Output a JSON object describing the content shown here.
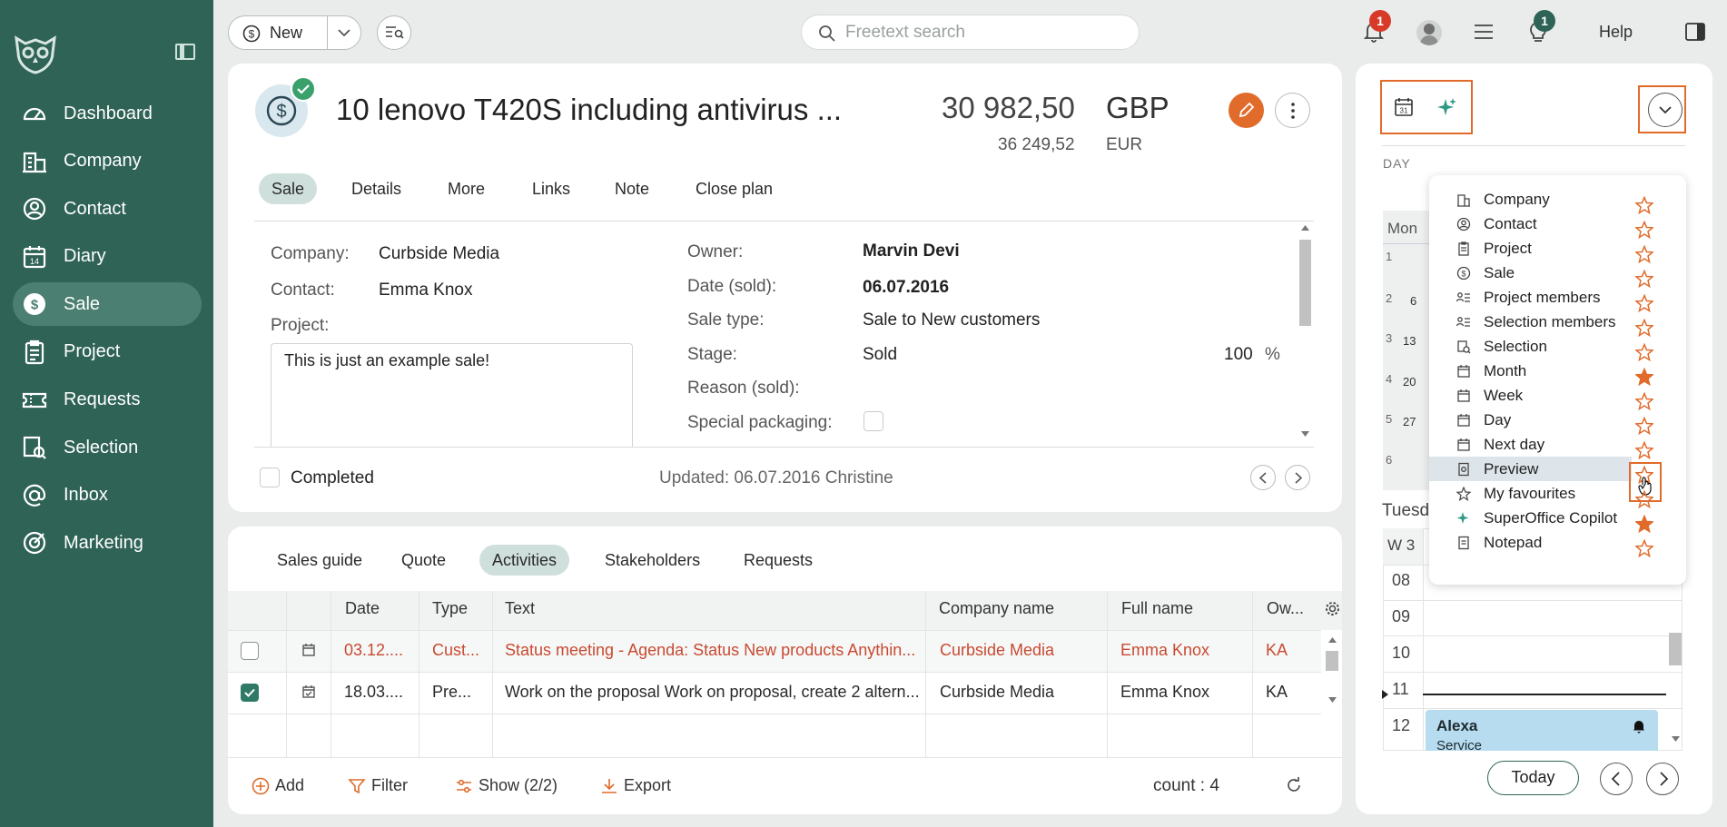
{
  "sidebar": {
    "items": [
      {
        "label": "Dashboard",
        "icon": "dashboard-icon"
      },
      {
        "label": "Company",
        "icon": "company-icon"
      },
      {
        "label": "Contact",
        "icon": "contact-icon"
      },
      {
        "label": "Diary",
        "icon": "diary-icon"
      },
      {
        "label": "Sale",
        "icon": "sale-icon"
      },
      {
        "label": "Project",
        "icon": "project-icon"
      },
      {
        "label": "Requests",
        "icon": "requests-icon"
      },
      {
        "label": "Selection",
        "icon": "selection-icon"
      },
      {
        "label": "Inbox",
        "icon": "inbox-icon"
      },
      {
        "label": "Marketing",
        "icon": "marketing-icon"
      }
    ],
    "active": "Sale"
  },
  "topbar": {
    "new_label": "New",
    "search_placeholder": "Freetext search",
    "notifications_count": "1",
    "tips_count": "1",
    "help_label": "Help"
  },
  "sale": {
    "title": "10 lenovo T420S including antivirus ...",
    "amount": "30 982,50",
    "currency": "GBP",
    "amount_secondary": "36 249,52",
    "currency_secondary": "EUR",
    "tabs": [
      "Sale",
      "Details",
      "More",
      "Links",
      "Note",
      "Close plan"
    ],
    "company_label": "Company:",
    "company_value": "Curbside Media",
    "contact_label": "Contact:",
    "contact_value": "Emma Knox",
    "project_label": "Project:",
    "description": "This is just an example sale!",
    "owner_label": "Owner:",
    "owner_value": "Marvin Devi",
    "date_label": "Date (sold):",
    "date_value": "06.07.2016",
    "sale_type_label": "Sale type:",
    "sale_type_value": "Sale to New customers",
    "stage_label": "Stage:",
    "stage_value": "Sold",
    "stage_percent": "100",
    "percent_sign": "%",
    "reason_label": "Reason (sold):",
    "special_label": "Special packaging:",
    "completed_label": "Completed",
    "updated_text": "Updated: 06.07.2016 Christine"
  },
  "activities": {
    "tabs": [
      "Sales guide",
      "Quote",
      "Activities",
      "Stakeholders",
      "Requests"
    ],
    "columns": [
      "Date",
      "Type",
      "Text",
      "Company name",
      "Full name",
      "Ow..."
    ],
    "rows": [
      {
        "date": "03.12....",
        "type": "Cust...",
        "text": "Status meeting - Agenda: Status New products Anythin...",
        "company": "Curbside Media",
        "name": "Emma Knox",
        "owner": "KA",
        "checked": false
      },
      {
        "date": "18.03....",
        "type": "Pre...",
        "text": "Work on the proposal Work on proposal, create 2 altern...",
        "company": "Curbside Media",
        "name": "Emma Knox",
        "owner": "KA",
        "checked": true
      }
    ],
    "add_label": "Add",
    "filter_label": "Filter",
    "show_label": "Show (2/2)",
    "export_label": "Export",
    "count_label": "count : 4"
  },
  "panel": {
    "day_label": "DAY",
    "calendar_icon_day": "31",
    "mon_label": "Mon",
    "week_rows": [
      {
        "wk": "1",
        "d": ""
      },
      {
        "wk": "2",
        "d": "6"
      },
      {
        "wk": "3",
        "d": "13"
      },
      {
        "wk": "4",
        "d": "20"
      },
      {
        "wk": "5",
        "d": "27"
      },
      {
        "wk": "6",
        "d": ""
      }
    ],
    "tuesday_label": "Tuesd",
    "week_label": "W 3",
    "hours": [
      "08",
      "09",
      "10",
      "11",
      "12"
    ],
    "event_title": "Alexa",
    "event_sub": "Service",
    "today_label": "Today",
    "menu": [
      {
        "label": "Company",
        "icon": "company-icon",
        "fav": false
      },
      {
        "label": "Contact",
        "icon": "contact-icon",
        "fav": false
      },
      {
        "label": "Project",
        "icon": "project-icon",
        "fav": false
      },
      {
        "label": "Sale",
        "icon": "sale-icon",
        "fav": false
      },
      {
        "label": "Project members",
        "icon": "members-icon",
        "fav": false
      },
      {
        "label": "Selection members",
        "icon": "members-icon",
        "fav": false
      },
      {
        "label": "Selection",
        "icon": "selection-icon",
        "fav": false
      },
      {
        "label": "Month",
        "icon": "calendar-icon",
        "fav": true
      },
      {
        "label": "Week",
        "icon": "calendar-icon",
        "fav": false
      },
      {
        "label": "Day",
        "icon": "calendar-icon",
        "fav": false
      },
      {
        "label": "Next day",
        "icon": "calendar-icon",
        "fav": false
      },
      {
        "label": "Preview",
        "icon": "preview-icon",
        "fav": false
      },
      {
        "label": "My favourites",
        "icon": "star-icon",
        "fav": false
      },
      {
        "label": "SuperOffice Copilot",
        "icon": "sparkle-icon",
        "fav": true
      },
      {
        "label": "Notepad",
        "icon": "notepad-icon",
        "fav": false
      }
    ]
  },
  "colors": {
    "sidebar": "#2f6356",
    "accent_orange": "#e06b2b",
    "link_blue": "#3f66a8",
    "highlight_red": "#c84a32"
  }
}
